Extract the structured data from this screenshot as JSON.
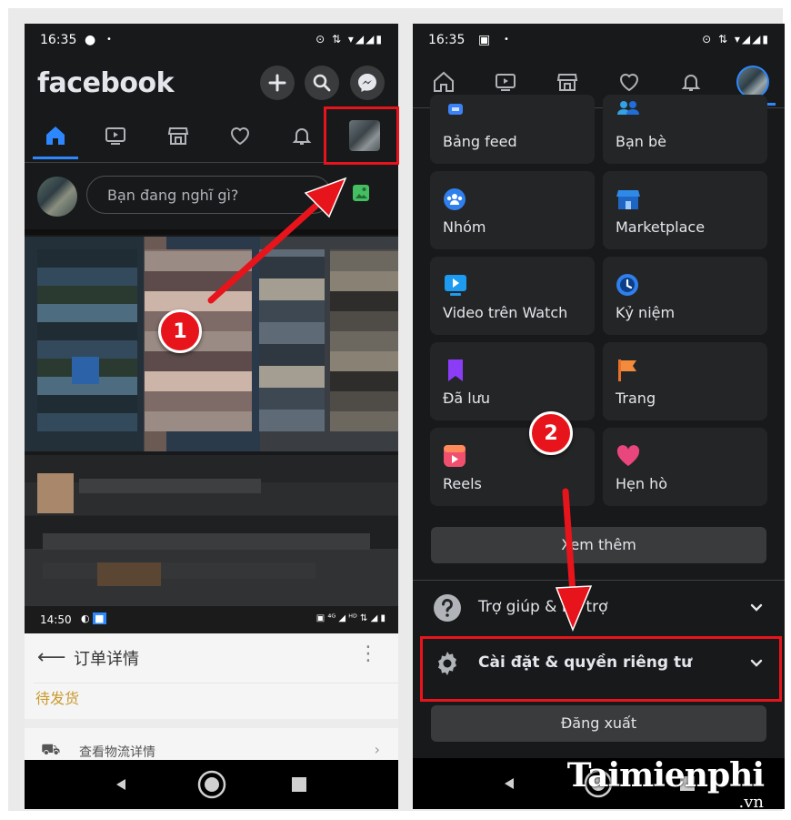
{
  "left_phone": {
    "status": {
      "time": "16:35",
      "icons": "⊙ ⇅ ▾◢◢▮"
    },
    "header": {
      "logo": "facebook"
    },
    "composer": {
      "placeholder": "Bạn đang nghĩ gì?"
    },
    "second_app": {
      "status_time": "14:50",
      "status_icons": "▣ ⁴ᴳ ◢ ᴴᴰ ⇅ ◢ ▮",
      "title": "订单详情",
      "status_label": "待发货",
      "row_label": "查看物流详情"
    }
  },
  "right_phone": {
    "status": {
      "time": "16:35",
      "icons": "⊙ ⇅ ▾◢◢▮"
    },
    "shortcuts": [
      {
        "label": "Bảng feed",
        "icon": "feed-icon"
      },
      {
        "label": "Bạn bè",
        "icon": "friends-icon"
      },
      {
        "label": "Nhóm",
        "icon": "groups-icon"
      },
      {
        "label": "Marketplace",
        "icon": "marketplace-icon"
      },
      {
        "label": "Video trên Watch",
        "icon": "watch-icon"
      },
      {
        "label": "Kỷ niệm",
        "icon": "memories-icon"
      },
      {
        "label": "Đã lưu",
        "icon": "saved-icon"
      },
      {
        "label": "Trang",
        "icon": "pages-icon"
      },
      {
        "label": "Reels",
        "icon": "reels-icon"
      },
      {
        "label": "Hẹn hò",
        "icon": "dating-icon"
      }
    ],
    "see_more": "Xem thêm",
    "help_row": "Trợ giúp & hỗ trợ",
    "settings_row": "Cài đặt & quyền riêng tư",
    "logout": "Đăng xuất"
  },
  "annotations": {
    "step1": "1",
    "step2": "2"
  },
  "watermark": {
    "main": "Taimienphi",
    "domain": ".vn"
  },
  "colors": {
    "accent": "#2d88ff",
    "annotation_red": "#e8141c",
    "background_dark": "#18191a"
  }
}
